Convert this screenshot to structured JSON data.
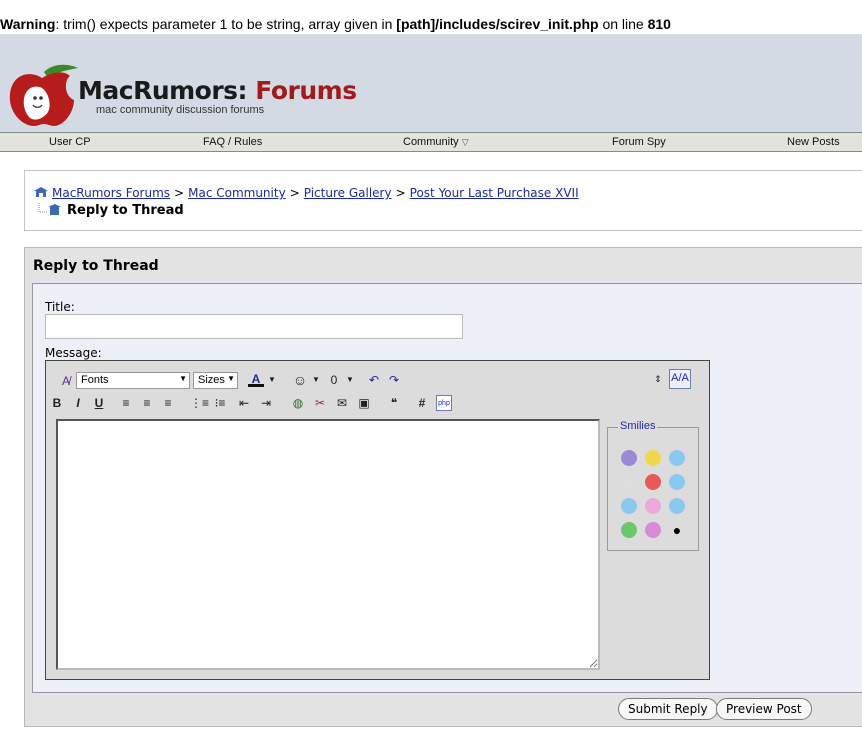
{
  "warning": {
    "prefix": "Warning",
    "message": ": trim() expects parameter 1 to be string, array given in ",
    "path": "[path]/includes/scirev_init.php",
    "mid": " on line ",
    "line": "810"
  },
  "logo": {
    "brand": "MacRumors:",
    "brand_accent": "Forums",
    "tagline": "mac community discussion forums"
  },
  "nav": {
    "items": [
      "User CP",
      "FAQ / Rules",
      "Community",
      "Forum Spy",
      "New Posts"
    ]
  },
  "breadcrumb": {
    "links": [
      "MacRumors Forums",
      "Mac Community",
      "Picture Gallery",
      "Post Your Last Purchase XVII"
    ],
    "separator": ">",
    "current": "Reply to Thread"
  },
  "form": {
    "panel_title": "Reply to Thread",
    "title_label": "Title:",
    "title_value": "",
    "message_label": "Message:",
    "fonts_select": "Fonts",
    "sizes_select": "Sizes",
    "smilies_legend": "Smilies",
    "submit_label": "Submit Reply",
    "preview_label": "Preview Post"
  },
  "colors": {
    "link": "#1c2a9a",
    "brand_red": "#a11b1b",
    "header_bg": "#d4dae4"
  }
}
